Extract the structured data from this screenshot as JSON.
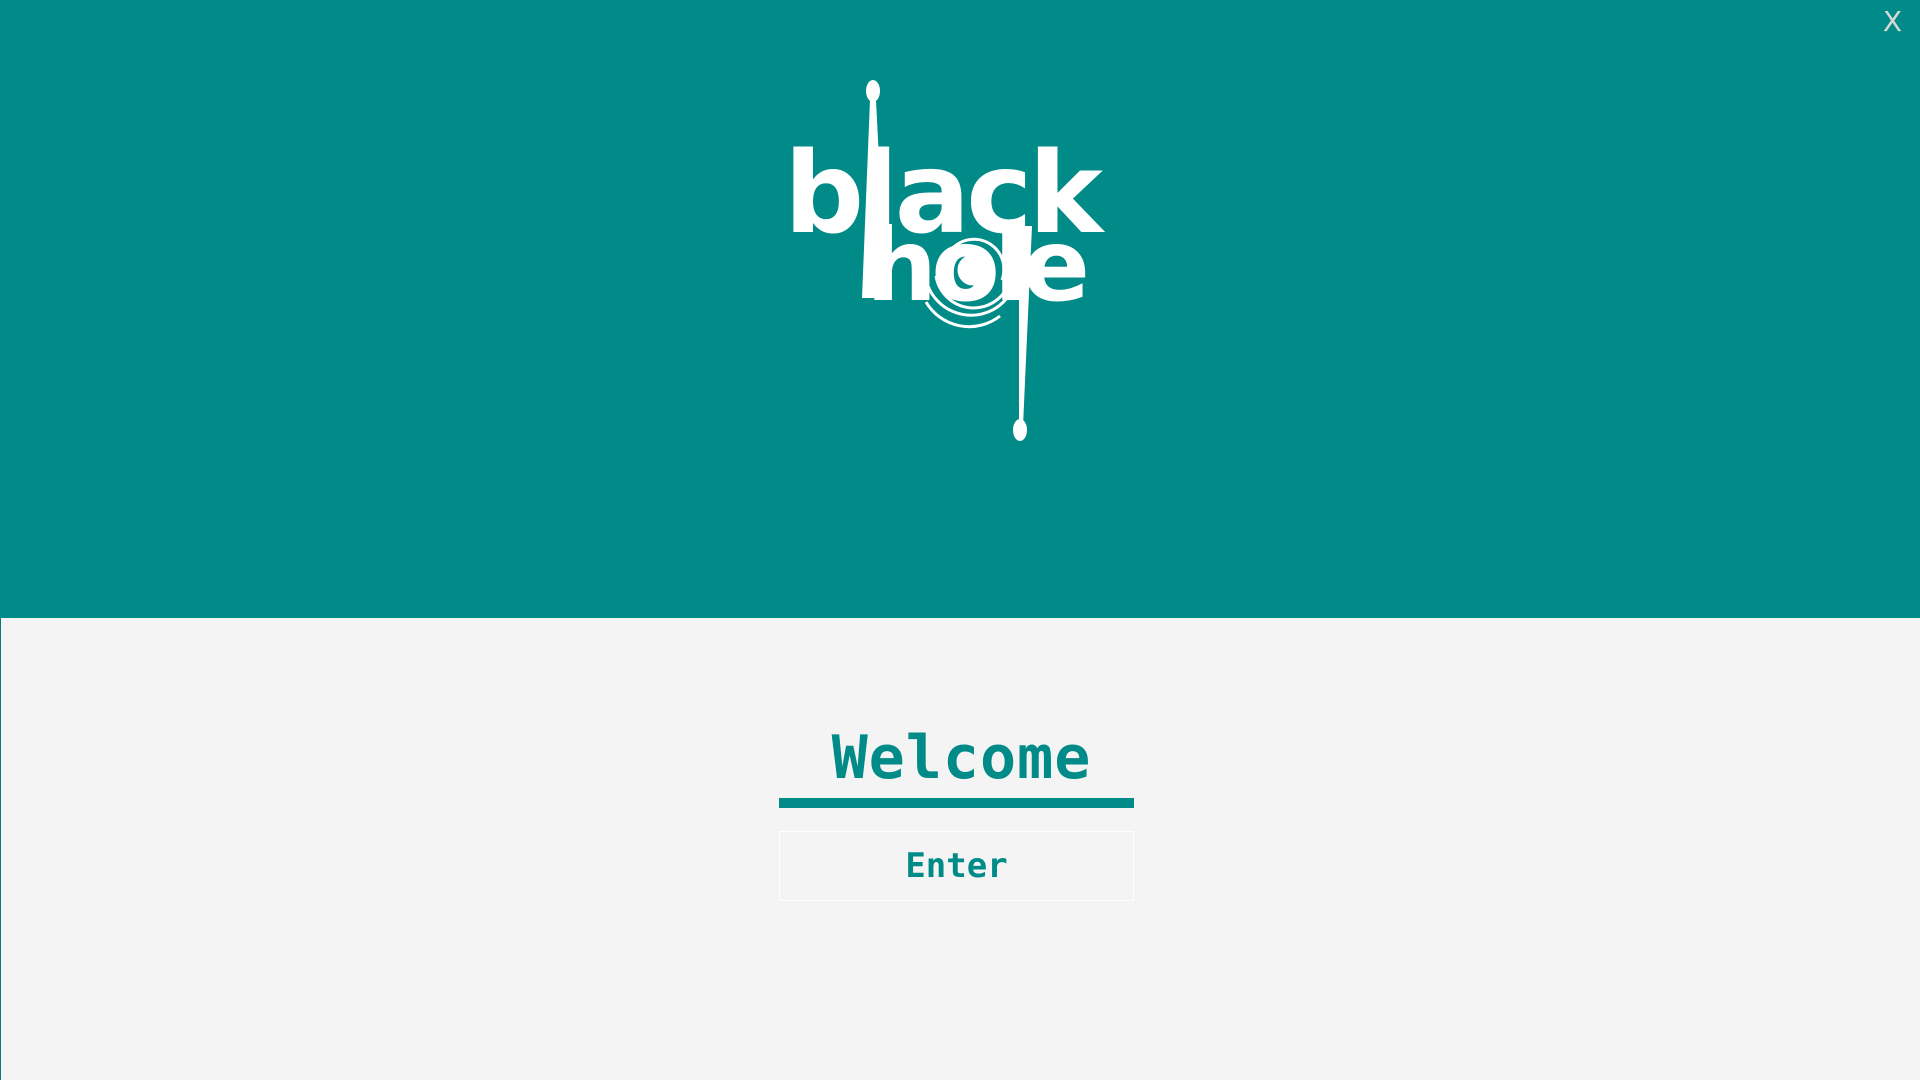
{
  "header": {
    "close_label": "X",
    "background_color": "#008b88",
    "logo": {
      "icon": "blackhole-logo-icon",
      "line1": "black",
      "line2": "hole",
      "color": "#ffffff"
    }
  },
  "main": {
    "title": "Welcome",
    "enter_label": "Enter",
    "accent_color": "#008b88",
    "background_color": "#f4f4f4"
  }
}
